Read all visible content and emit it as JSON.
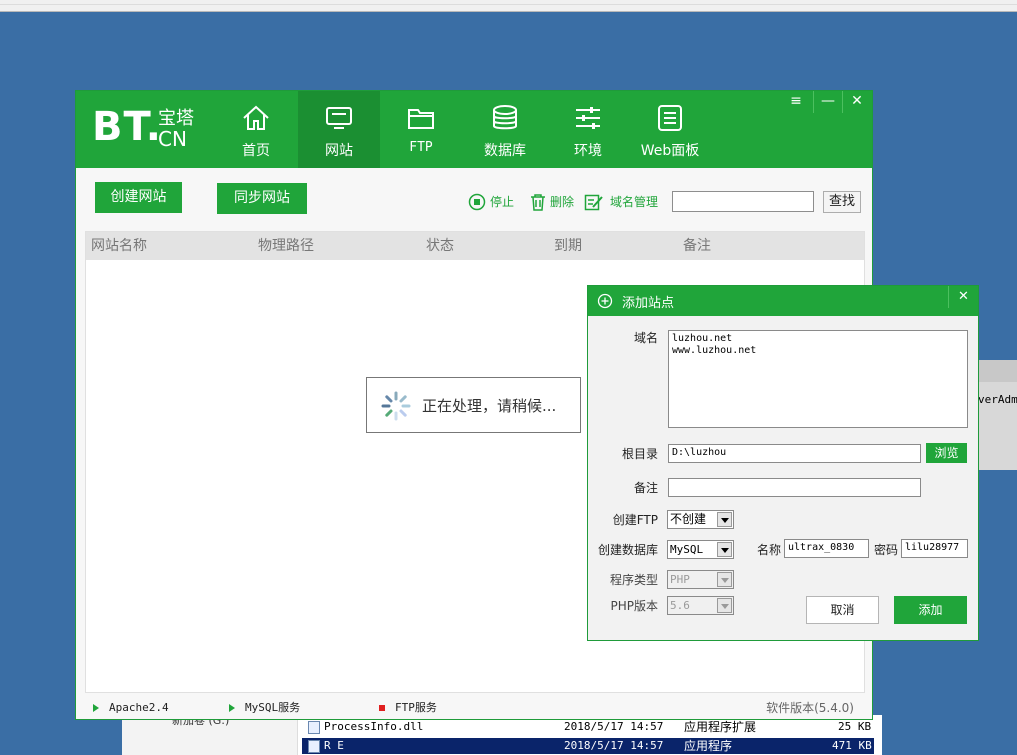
{
  "background": {
    "files": [
      {
        "name": "ProcessInfo.dll",
        "date": "2018/5/17 14:57",
        "type": "应用程序扩展",
        "size": "25 KB"
      },
      {
        "name": "R  E",
        "date": "2018/5/17 14:57",
        "type": "应用程序",
        "size": "471 KB"
      }
    ],
    "sidebar_item": "新加卷 (G:)",
    "right_window_text": "verAdmi"
  },
  "app": {
    "logo_main": "BT.",
    "logo_top": "宝塔",
    "logo_bottom": "CN",
    "nav": [
      {
        "label": "首页",
        "icon": "home-icon"
      },
      {
        "label": "网站",
        "icon": "monitor-icon"
      },
      {
        "label": "FTP",
        "icon": "folder-icon"
      },
      {
        "label": "数据库",
        "icon": "database-icon"
      },
      {
        "label": "环境",
        "icon": "sliders-icon"
      },
      {
        "label": "Web面板",
        "icon": "list-icon"
      }
    ],
    "window_buttons": {
      "menu": "≡",
      "minimize": "—",
      "close": "✕"
    }
  },
  "toolbar": {
    "create_site": "创建网站",
    "sync_site": "同步网站",
    "stop": "停止",
    "delete": "删除",
    "domain_manage": "域名管理",
    "search_value": "",
    "search_button": "查找"
  },
  "table": {
    "columns": [
      "网站名称",
      "物理路径",
      "状态",
      "到期",
      "备注"
    ]
  },
  "loading": {
    "text": "正在处理，请稍候..."
  },
  "statusbar": {
    "apache": "Apache2.4",
    "mysql": "MySQL服务",
    "ftp": "FTP服务",
    "version": "软件版本(5.4.0)"
  },
  "dialog": {
    "title": "添加站点",
    "close": "✕",
    "domain_label": "域名",
    "domain_value": "luzhou.net\nwww.luzhou.net",
    "root_label": "根目录",
    "root_value": "D:\\luzhou",
    "browse": "浏览",
    "note_label": "备注",
    "note_value": "",
    "ftp_label": "创建FTP",
    "ftp_value": "不创建",
    "db_label": "创建数据库",
    "db_value": "MySQL",
    "db_name_label": "名称",
    "db_name_value": "ultrax_0830",
    "db_pass_label": "密码",
    "db_pass_value": "lilu28977",
    "prog_label": "程序类型",
    "prog_value": "PHP",
    "php_label": "PHP版本",
    "php_value": "5.6",
    "cancel": "取消",
    "add": "添加"
  }
}
